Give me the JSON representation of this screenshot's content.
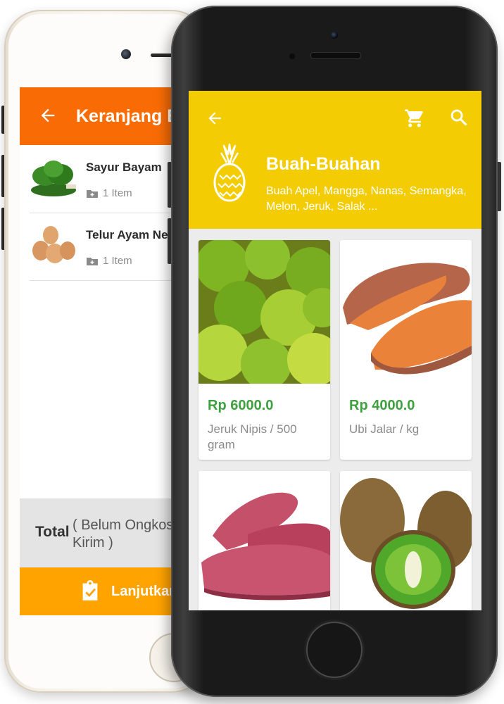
{
  "cart_screen": {
    "title": "Keranjang Belanja",
    "items": [
      {
        "name": "Sayur Bayam",
        "qty": "1 Item"
      },
      {
        "name": "Telur Ayam Negeri",
        "qty": "1 Item"
      }
    ],
    "total_label": "Total",
    "total_note": "( Belum Ongkos Kirim )",
    "continue_label": "Lanjutkan"
  },
  "category_screen": {
    "category_title": "Buah-Buahan",
    "category_desc": "Buah Apel, Mangga, Nanas, Semangka, Melon, Jeruk, Salak ...",
    "products": [
      {
        "price": "Rp 6000.0",
        "name": "Jeruk Nipis / 500 gram"
      },
      {
        "price": "Rp 4000.0",
        "name": "Ubi Jalar / kg"
      },
      {
        "price": "",
        "name": ""
      },
      {
        "price": "",
        "name": ""
      }
    ]
  },
  "colors": {
    "cart_appbar": "#f96c05",
    "cart_continue": "#ffa300",
    "category_header": "#f4cc04",
    "price_green": "#3fa040"
  },
  "icons": {
    "back": "arrow-left-icon",
    "cart": "shopping-cart-icon",
    "search": "search-icon",
    "category": "pineapple-icon",
    "qty": "folder-plus-icon",
    "continue": "clipboard-check-icon"
  }
}
